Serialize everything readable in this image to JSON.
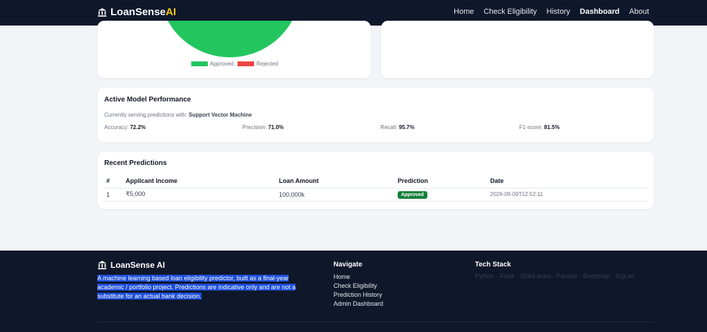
{
  "navbar": {
    "brand_main": "LoanSense",
    "brand_accent": "AI",
    "links": [
      {
        "label": "Home"
      },
      {
        "label": "Check Eligibility"
      },
      {
        "label": "History"
      },
      {
        "label": "Dashboard"
      },
      {
        "label": "About"
      }
    ]
  },
  "pie_chart": {
    "colors": {
      "approved": "#22c55e",
      "rejected": "#ef4444"
    },
    "legend": {
      "approved": "Approved",
      "rejected": "Rejected"
    }
  },
  "chart_data": {
    "type": "pie",
    "categories": [
      "Approved",
      "Rejected"
    ],
    "values": [
      1,
      0
    ]
  },
  "performance": {
    "title": "Active Model Performance",
    "serving_label": "Currently serving predictions with:",
    "model": "Support Vector Machine",
    "metrics": [
      {
        "label": "Accuracy:",
        "value": "72.2%"
      },
      {
        "label": "Precision:",
        "value": "71.0%"
      },
      {
        "label": "Recall:",
        "value": "95.7%"
      },
      {
        "label": "F1-score:",
        "value": "81.5%"
      }
    ]
  },
  "recent": {
    "title": "Recent Predictions",
    "columns": [
      "#",
      "Applicant Income",
      "Loan Amount",
      "Prediction",
      "Date"
    ],
    "rows": [
      {
        "num": "1",
        "income": "₹5,000",
        "amount": "100,000k",
        "prediction": "Approved",
        "date": "2026-09-09T12:52:11"
      }
    ]
  },
  "footer": {
    "brand": "LoanSense AI",
    "description": "A machine learning based loan eligibility predictor, built as a final-year academic / portfolio project. Predictions are indicative only and are not a substitute for an actual bank decision.",
    "navigate_title": "Navigate",
    "nav_links": [
      "Home",
      "Check Eligibility",
      "Prediction History",
      "Admin Dashboard"
    ],
    "tech_title": "Tech Stack",
    "tech_text": "Python · Flask · Scikit-learn · Pandas · Bootstrap · SQLite"
  }
}
